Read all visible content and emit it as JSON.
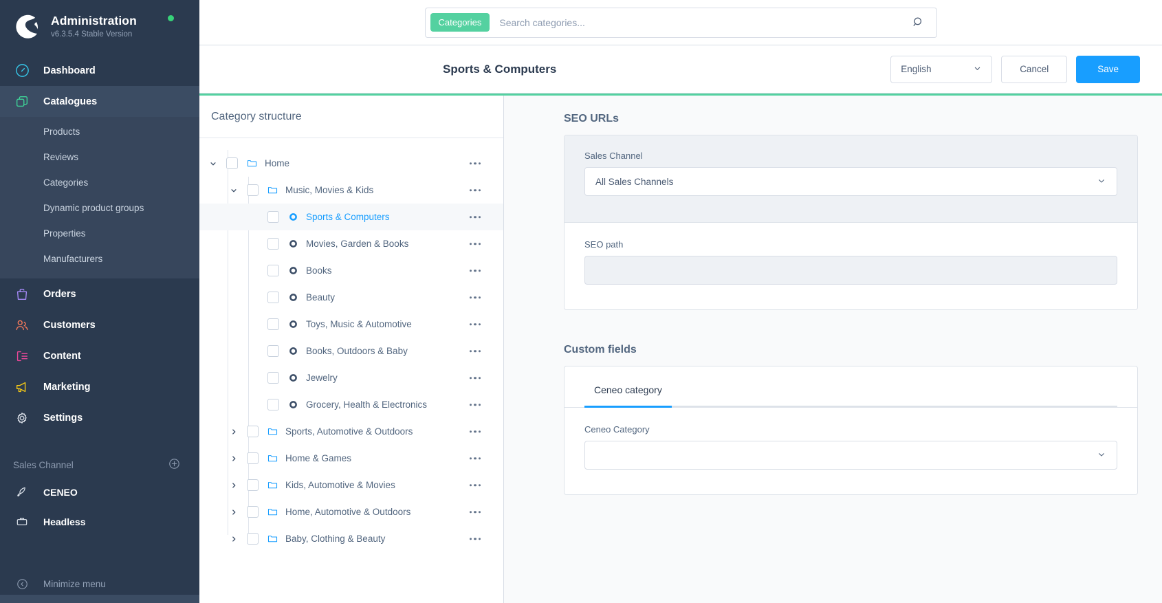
{
  "sidebar": {
    "title": "Administration",
    "version": "v6.3.5.4 Stable Version",
    "items": [
      {
        "label": "Dashboard",
        "icon": "dashboard-icon"
      },
      {
        "label": "Catalogues",
        "icon": "catalogues-icon"
      }
    ],
    "sub_items": [
      {
        "label": "Products"
      },
      {
        "label": "Reviews"
      },
      {
        "label": "Categories"
      },
      {
        "label": "Dynamic product groups"
      },
      {
        "label": "Properties"
      },
      {
        "label": "Manufacturers"
      }
    ],
    "items_lower": [
      {
        "label": "Orders",
        "icon": "bag-icon"
      },
      {
        "label": "Customers",
        "icon": "users-icon"
      },
      {
        "label": "Content",
        "icon": "content-icon"
      },
      {
        "label": "Marketing",
        "icon": "megaphone-icon"
      },
      {
        "label": "Settings",
        "icon": "gear-icon"
      }
    ],
    "section_label": "Sales Channel",
    "channels": [
      {
        "label": "CENEO",
        "icon": "rocket-icon"
      },
      {
        "label": "Headless",
        "icon": "headless-icon"
      }
    ],
    "minimize_label": "Minimize menu"
  },
  "search": {
    "chip_label": "Categories",
    "placeholder": "Search categories...",
    "value": ""
  },
  "smartbar": {
    "title": "Sports & Computers",
    "language": "English",
    "cancel_label": "Cancel",
    "save_label": "Save"
  },
  "tree": {
    "header": "Category structure",
    "rows": [
      {
        "label": "Home",
        "depth": 0,
        "type": "folder",
        "expanded": true,
        "selected": false
      },
      {
        "label": "Music, Movies & Kids",
        "depth": 1,
        "type": "folder",
        "expanded": true,
        "selected": false
      },
      {
        "label": "Sports & Computers",
        "depth": 2,
        "type": "leaf",
        "expanded": null,
        "selected": true
      },
      {
        "label": "Movies, Garden & Books",
        "depth": 2,
        "type": "leaf",
        "expanded": null,
        "selected": false
      },
      {
        "label": "Books",
        "depth": 2,
        "type": "leaf",
        "expanded": null,
        "selected": false
      },
      {
        "label": "Beauty",
        "depth": 2,
        "type": "leaf",
        "expanded": null,
        "selected": false
      },
      {
        "label": "Toys, Music & Automotive",
        "depth": 2,
        "type": "leaf",
        "expanded": null,
        "selected": false
      },
      {
        "label": "Books, Outdoors & Baby",
        "depth": 2,
        "type": "leaf",
        "expanded": null,
        "selected": false
      },
      {
        "label": "Jewelry",
        "depth": 2,
        "type": "leaf",
        "expanded": null,
        "selected": false
      },
      {
        "label": "Grocery, Health & Electronics",
        "depth": 2,
        "type": "leaf",
        "expanded": null,
        "selected": false
      },
      {
        "label": "Sports, Automotive & Outdoors",
        "depth": 1,
        "type": "folder",
        "expanded": false,
        "selected": false
      },
      {
        "label": "Home & Games",
        "depth": 1,
        "type": "folder",
        "expanded": false,
        "selected": false
      },
      {
        "label": "Kids, Automotive & Movies",
        "depth": 1,
        "type": "folder",
        "expanded": false,
        "selected": false
      },
      {
        "label": "Home, Automotive & Outdoors",
        "depth": 1,
        "type": "folder",
        "expanded": false,
        "selected": false
      },
      {
        "label": "Baby, Clothing & Beauty",
        "depth": 1,
        "type": "folder",
        "expanded": false,
        "selected": false
      }
    ]
  },
  "seo": {
    "title": "SEO URLs",
    "sales_channel_label": "Sales Channel",
    "sales_channel_value": "All Sales Channels",
    "seo_path_label": "SEO path",
    "seo_path_value": ""
  },
  "custom_fields": {
    "title": "Custom fields",
    "tab_label": "Ceneo category",
    "field_label": "Ceneo Category",
    "field_value": ""
  },
  "colors": {
    "accent_blue": "#189eff",
    "accent_green": "#54d1a0",
    "sidebar_bg": "#2b3a4f",
    "status_dot": "#37d279"
  }
}
